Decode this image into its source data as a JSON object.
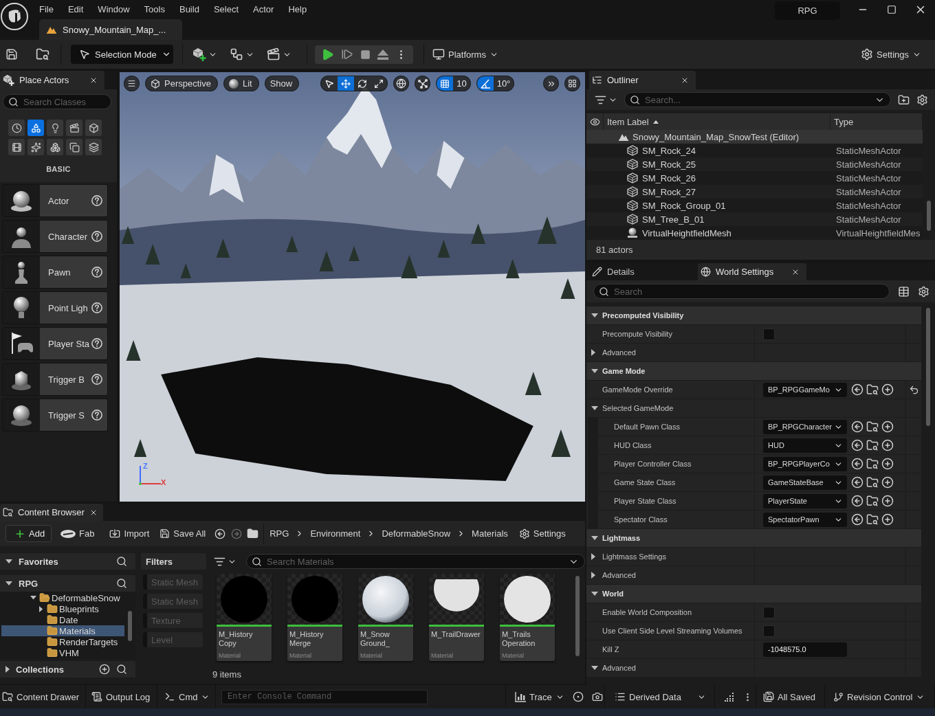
{
  "menu_bar": {
    "items": [
      "File",
      "Edit",
      "Window",
      "Tools",
      "Build",
      "Select",
      "Actor",
      "Help"
    ],
    "level_tab": "Snowy_Mountain_Map_...",
    "project": "RPG"
  },
  "toolbar": {
    "mode": "Selection Mode",
    "platforms": "Platforms",
    "settings": "Settings"
  },
  "place_actors": {
    "title": "Place Actors",
    "search": {
      "placeholder": "Search Classes"
    },
    "categories": [
      {
        "selected": false
      },
      {
        "selected": true
      },
      {
        "selected": false
      },
      {
        "selected": false
      },
      {
        "selected": false
      },
      {
        "selected": false
      },
      {
        "selected": false
      },
      {
        "selected": false
      },
      {
        "selected": false
      },
      {
        "selected": false
      }
    ],
    "section": "BASIC",
    "items": [
      "Actor",
      "Character",
      "Pawn",
      "Point Ligh",
      "Player Sta",
      "Trigger B",
      "Trigger S"
    ]
  },
  "viewport": {
    "view_mode": "Perspective",
    "lighting": "Lit",
    "show": "Show",
    "transform_tools": [
      {
        "selected": false
      },
      {
        "selected": true
      },
      {
        "selected": false
      },
      {
        "selected": false
      }
    ],
    "grid_snap": {
      "on": true,
      "value": "10"
    },
    "angle_snap": {
      "on": true,
      "value": "10°"
    },
    "axis": {
      "up": "Z",
      "right": "X"
    }
  },
  "outliner": {
    "title": "Outliner",
    "search": {
      "placeholder": "Search..."
    },
    "columns": [
      "Item Label",
      "Type"
    ],
    "tree": {
      "label": "Snowy_Mountain_Map_SnowTest (Editor)",
      "children": [
        {
          "kind": "mesh",
          "label": "SM_Rock_24",
          "type": "StaticMeshActor"
        },
        {
          "kind": "mesh",
          "label": "SM_Rock_25",
          "type": "StaticMeshActor"
        },
        {
          "kind": "mesh",
          "label": "SM_Rock_26",
          "type": "StaticMeshActor"
        },
        {
          "kind": "mesh",
          "label": "SM_Rock_27",
          "type": "StaticMeshActor"
        },
        {
          "kind": "mesh",
          "label": "SM_Rock_Group_01",
          "type": "StaticMeshActor"
        },
        {
          "kind": "mesh",
          "label": "SM_Tree_B_01",
          "type": "StaticMeshActor"
        },
        {
          "kind": "actor",
          "label": "VirtualHeightfieldMesh",
          "type": "VirtualHeightfieldMes"
        }
      ]
    },
    "footer": "81 actors"
  },
  "details": {
    "tabs": [
      {
        "label": "Details",
        "selected": false
      },
      {
        "label": "World Settings",
        "selected": true
      }
    ],
    "search": {
      "placeholder": "Search"
    },
    "categories": [
      {
        "title": "Precomputed Visibility",
        "expanded": true,
        "rows": [
          {
            "kind": "checkbox",
            "label": "Precompute Visibility",
            "checked": false
          },
          {
            "kind": "group",
            "label": "Advanced",
            "expanded": false
          }
        ]
      },
      {
        "title": "Game Mode",
        "expanded": true,
        "rows": [
          {
            "kind": "class",
            "label": "GameMode Override",
            "value": "BP_RPGGameMo",
            "modified": true
          },
          {
            "kind": "group",
            "label": "Selected GameMode",
            "expanded": true,
            "children": [
              {
                "kind": "class",
                "label": "Default Pawn Class",
                "value": "BP_RPGCharacter",
                "modified": false
              },
              {
                "kind": "class",
                "label": "HUD Class",
                "value": "HUD",
                "modified": false
              },
              {
                "kind": "class",
                "label": "Player Controller Class",
                "value": "BP_RPGPlayerCo",
                "modified": false
              },
              {
                "kind": "class",
                "label": "Game State Class",
                "value": "GameStateBase",
                "modified": false
              },
              {
                "kind": "class",
                "label": "Player State Class",
                "value": "PlayerState",
                "modified": false
              },
              {
                "kind": "class",
                "label": "Spectator Class",
                "value": "SpectatorPawn",
                "modified": false
              }
            ]
          }
        ]
      },
      {
        "title": "Lightmass",
        "expanded": true,
        "rows": [
          {
            "kind": "group",
            "label": "Lightmass Settings",
            "expanded": false
          },
          {
            "kind": "group",
            "label": "Advanced",
            "expanded": false
          }
        ]
      },
      {
        "title": "World",
        "expanded": true,
        "rows": [
          {
            "kind": "checkbox",
            "label": "Enable World Composition",
            "checked": false
          },
          {
            "kind": "checkbox",
            "label": "Use Client Side Level Streaming Volumes",
            "checked": false
          },
          {
            "kind": "number",
            "label": "Kill Z",
            "value": "-1048575.0"
          },
          {
            "kind": "group",
            "label": "Advanced",
            "expanded": true
          }
        ]
      }
    ]
  },
  "content_browser": {
    "title": "Content Browser",
    "actions": {
      "add": "Add",
      "fab": "Fab",
      "import": "Import",
      "save_all": "Save All",
      "settings": "Settings"
    },
    "path": [
      "RPG",
      "Environment",
      "DeformableSnow",
      "Materials"
    ],
    "favorites": {
      "title": "Favorites",
      "expanded": true
    },
    "root": {
      "title": "RPG",
      "expanded": true,
      "tree": [
        {
          "label": "DeformableSnow",
          "expandable": true,
          "expanded": true,
          "selected": false,
          "children": [
            {
              "label": "Blueprints",
              "expandable": true,
              "expanded": false,
              "selected": false
            },
            {
              "label": "Date",
              "expandable": false,
              "expanded": false,
              "selected": false
            },
            {
              "label": "Materials",
              "expandable": false,
              "expanded": false,
              "selected": true
            },
            {
              "label": "RenderTargets",
              "expandable": false,
              "expanded": false,
              "selected": false
            },
            {
              "label": "VHM",
              "expandable": false,
              "expanded": false,
              "selected": false
            }
          ]
        }
      ]
    },
    "collections": {
      "title": "Collections",
      "expanded": false
    },
    "filters": {
      "title": "Filters",
      "items": [
        {
          "label": "Static Mesh",
          "active": false
        },
        {
          "label": "Static Mesh",
          "active": false
        },
        {
          "label": "Texture",
          "active": false
        },
        {
          "label": "Level",
          "active": false
        }
      ]
    },
    "search": {
      "placeholder": "Search Materials"
    },
    "assets": [
      {
        "kind": "dark_sphere",
        "name": "M_History\nCopy",
        "type": "Material"
      },
      {
        "kind": "dark_sphere",
        "name": "M_History\nMerge",
        "type": "Material"
      },
      {
        "kind": "snow_sphere",
        "name": "M_Snow\nGround_",
        "type": "Material"
      },
      {
        "kind": "clipped_sphere",
        "name": "M_TrailDrawer",
        "type": "Material"
      },
      {
        "kind": "light_sphere",
        "name": "M_Trails\nOperation",
        "type": "Material"
      }
    ],
    "count": "9 items"
  },
  "status_bar": {
    "content_drawer": "Content Drawer",
    "output_log": "Output Log",
    "cmd": "Cmd",
    "console": {
      "placeholder": "Enter Console Command"
    },
    "trace": "Trace",
    "derived_data": "Derived Data",
    "save_state": "All Saved",
    "revision_control": "Revision Control"
  }
}
